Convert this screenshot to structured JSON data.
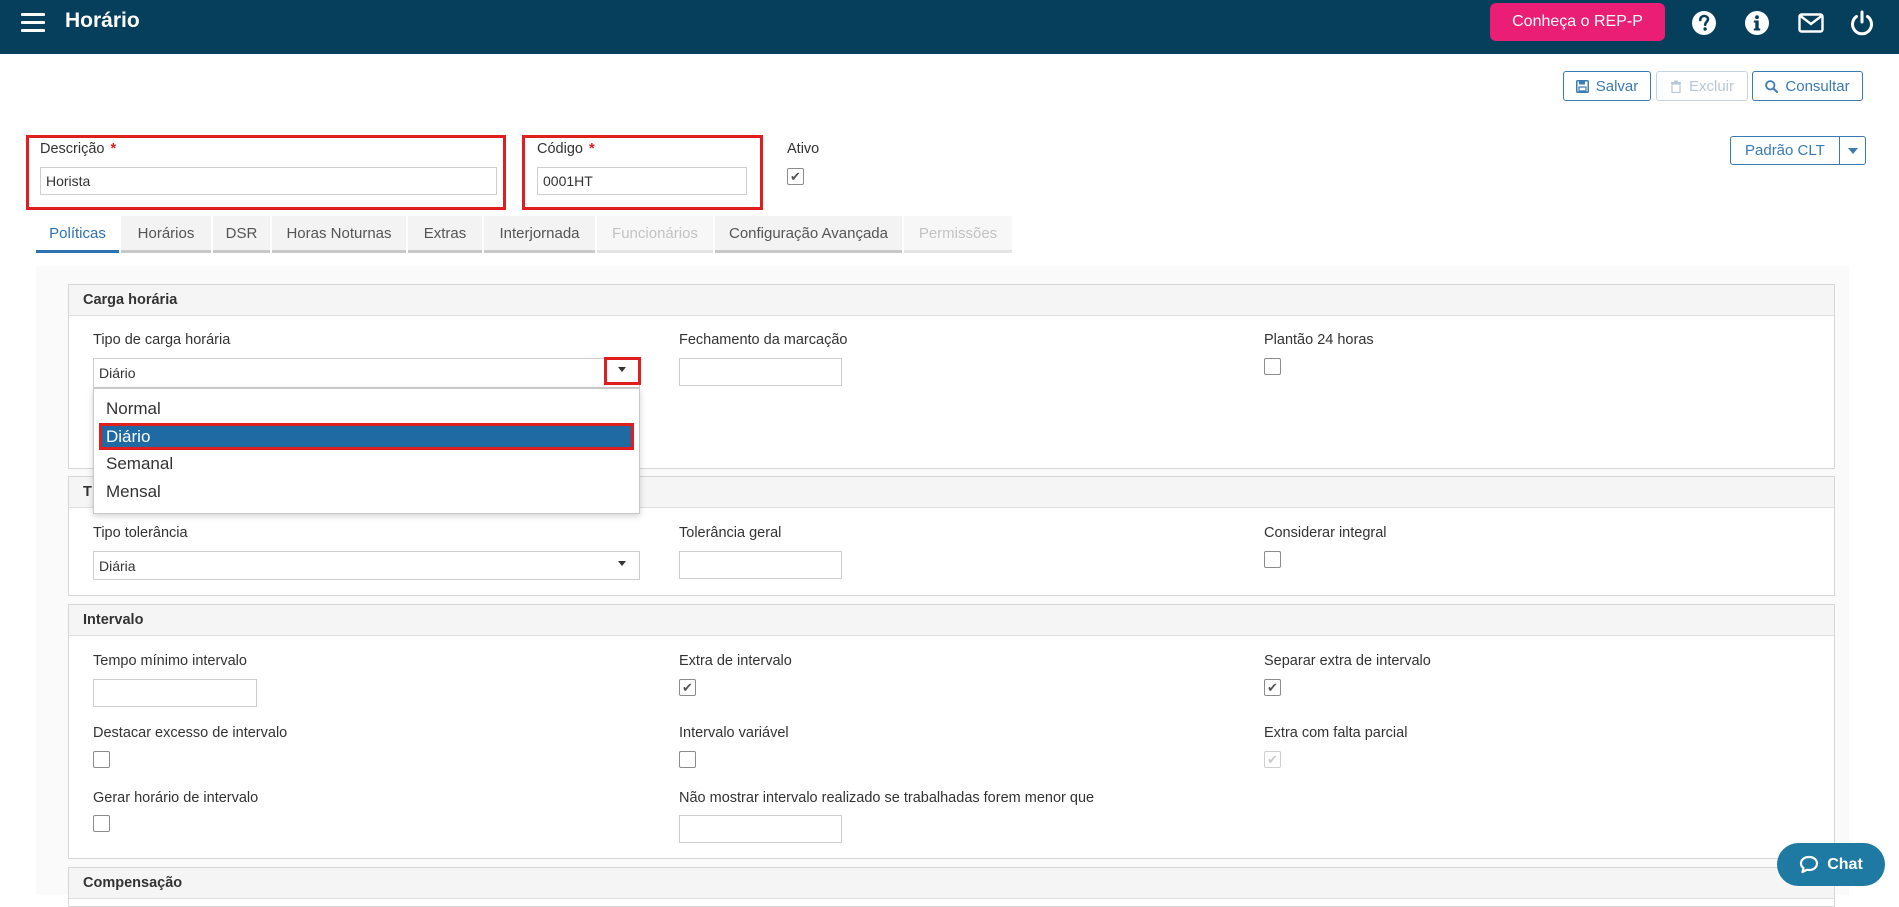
{
  "header": {
    "title": "Horário",
    "rep_button": "Conheça o REP-P",
    "icons": [
      "help-icon",
      "info-icon",
      "mail-icon",
      "power-icon"
    ]
  },
  "toolbar": {
    "save": "Salvar",
    "delete": "Excluir",
    "query": "Consultar"
  },
  "form": {
    "descricao_label": "Descrição",
    "descricao_value": "Horista",
    "codigo_label": "Código",
    "codigo_value": "0001HT",
    "required_mark": "*",
    "ativo_label": "Ativo",
    "ativo_checked": true,
    "padrao_label": "Padrão CLT"
  },
  "tabs": [
    {
      "label": "Políticas",
      "state": "active"
    },
    {
      "label": "Horários",
      "state": "normal"
    },
    {
      "label": "DSR",
      "state": "normal"
    },
    {
      "label": "Horas Noturnas",
      "state": "normal"
    },
    {
      "label": "Extras",
      "state": "normal"
    },
    {
      "label": "Interjornada",
      "state": "normal"
    },
    {
      "label": "Funcionários",
      "state": "disabled"
    },
    {
      "label": "Configuração Avançada",
      "state": "normal"
    },
    {
      "label": "Permissões",
      "state": "disabled"
    }
  ],
  "carga": {
    "title": "Carga horária",
    "tipo_label": "Tipo de carga horária",
    "tipo_value": "Diário",
    "fechamento_label": "Fechamento da marcação",
    "fechamento_value": "",
    "plantao_label": "Plantão 24 horas",
    "options": [
      "Normal",
      "Diário",
      "Semanal",
      "Mensal"
    ],
    "selected_option": "Diário"
  },
  "tolerancia": {
    "title_visible_fragment": "T",
    "tipo_label": "Tipo tolerância",
    "tipo_value": "Diária",
    "geral_label": "Tolerância geral",
    "integral_label": "Considerar integral"
  },
  "intervalo": {
    "title": "Intervalo",
    "tempo_minimo_label": "Tempo mínimo intervalo",
    "extra_label": "Extra de intervalo",
    "separar_label": "Separar extra de intervalo",
    "destacar_label": "Destacar excesso de intervalo",
    "variavel_label": "Intervalo variável",
    "falta_parcial_label": "Extra com falta parcial",
    "gerar_label": "Gerar horário de intervalo",
    "nao_mostrar_label": "Não mostrar intervalo realizado se trabalhadas forem menor que"
  },
  "compensacao": {
    "title": "Compensação"
  },
  "chat": {
    "label": "Chat"
  },
  "colors": {
    "topbar": "#053f5c",
    "accent_pink": "#ea1e74",
    "link_blue": "#3a7bb3",
    "selection_blue": "#1f6aa3",
    "highlight_red": "#e01e1e"
  }
}
